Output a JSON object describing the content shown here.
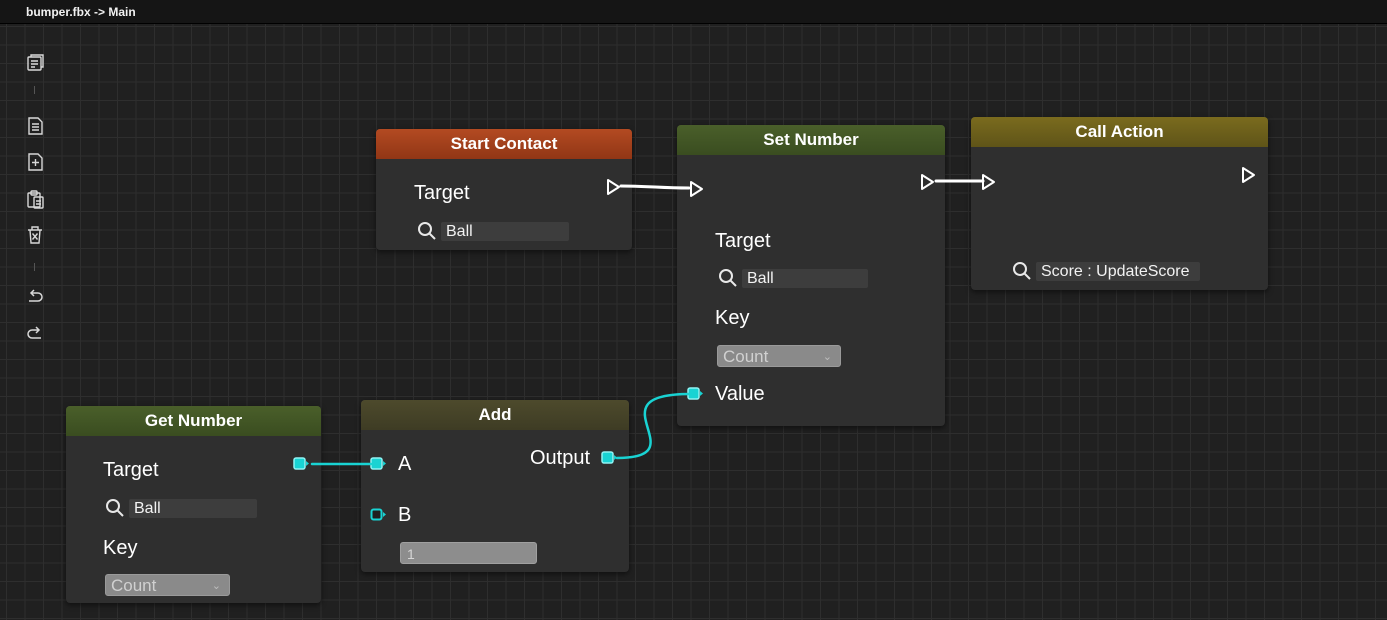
{
  "window": {
    "title": "bumper.fbx -> Main"
  },
  "toolbar": {
    "items": [
      {
        "name": "graph-icon"
      },
      {
        "name": "document-icon"
      },
      {
        "name": "add-file-icon"
      },
      {
        "name": "paste-icon"
      },
      {
        "name": "delete-icon"
      },
      {
        "name": "undo-icon"
      },
      {
        "name": "redo-icon"
      }
    ]
  },
  "colors": {
    "data_wire": "#19d3d3",
    "exec_wire": "#ffffff",
    "start_contact_header": "#a8401c",
    "set_number_header": "#435726",
    "call_action_header": "#6f621b",
    "get_number_header": "#435726",
    "add_header": "#46432a"
  },
  "nodes": {
    "start_contact": {
      "title": "Start Contact",
      "target_label": "Target",
      "target_value": "Ball"
    },
    "set_number": {
      "title": "Set Number",
      "target_label": "Target",
      "target_value": "Ball",
      "key_label": "Key",
      "key_value": "Count",
      "value_label": "Value"
    },
    "call_action": {
      "title": "Call Action",
      "action_value": "Score : UpdateScore"
    },
    "get_number": {
      "title": "Get Number",
      "target_label": "Target",
      "target_value": "Ball",
      "key_label": "Key",
      "key_value": "Count"
    },
    "add": {
      "title": "Add",
      "a_label": "A",
      "b_label": "B",
      "output_label": "Output",
      "b_value": "1"
    }
  }
}
